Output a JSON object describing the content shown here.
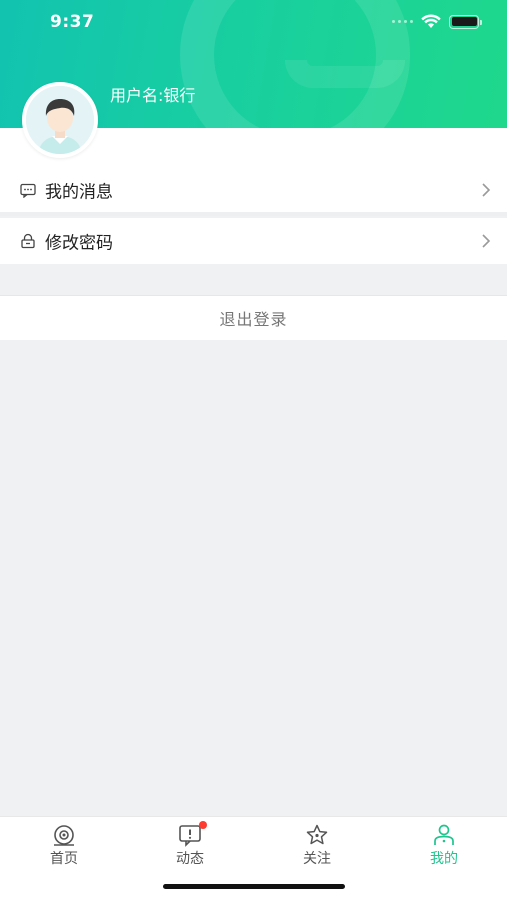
{
  "status_bar": {
    "time": "9:37"
  },
  "profile": {
    "username": "用户名:银行"
  },
  "menu": {
    "items": [
      {
        "label": "我的消息",
        "icon": "message-icon"
      },
      {
        "label": "修改密码",
        "icon": "lock-icon"
      }
    ],
    "logout_label": "退出登录"
  },
  "tabbar": {
    "tabs": [
      {
        "label": "首页",
        "icon": "eye-icon",
        "active": false
      },
      {
        "label": "动态",
        "icon": "alert-icon",
        "active": false,
        "badge": true
      },
      {
        "label": "关注",
        "icon": "star-icon",
        "active": false
      },
      {
        "label": "我的",
        "icon": "person-icon",
        "active": true
      }
    ]
  },
  "colors": {
    "accent": "#1fc48e",
    "header_gradient_start": "#12c3b0",
    "header_gradient_end": "#1fd88c",
    "badge": "#ff3b30"
  }
}
